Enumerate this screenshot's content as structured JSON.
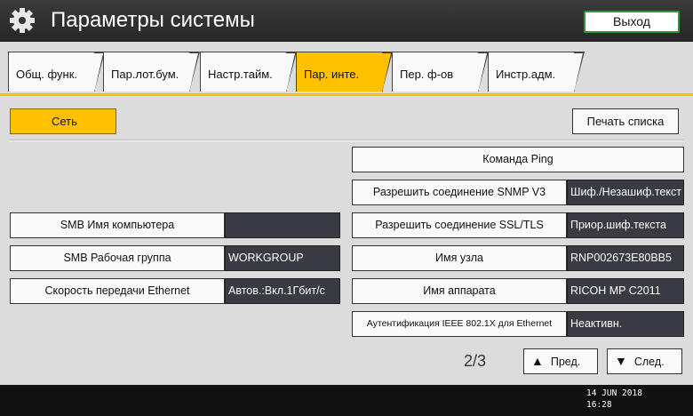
{
  "header": {
    "title": "Параметры системы",
    "exit_label": "Выход",
    "icon": "gear-icon"
  },
  "tabs": [
    {
      "label": "Общ. функ.",
      "active": false
    },
    {
      "label": "Пар.лот.бум.",
      "active": false
    },
    {
      "label": "Настр.тайм.",
      "active": false
    },
    {
      "label": "Пар. инте.",
      "active": true
    },
    {
      "label": "Пер. ф-ов",
      "active": false
    },
    {
      "label": "Инстр.адм.",
      "active": false
    }
  ],
  "toolbar": {
    "network_label": "Сеть",
    "print_list_label": "Печать списка"
  },
  "left_settings": [
    {
      "label": "SMB Имя компьютера",
      "value": ""
    },
    {
      "label": "SMB Рабочая группа",
      "value": "WORKGROUP"
    },
    {
      "label": "Скорость передачи Ethernet",
      "value": "Автов.:Вкл.1Гбит/с"
    }
  ],
  "right_settings": {
    "ping_label": "Команда Ping",
    "items": [
      {
        "label": "Разрешить соединение SNMP V3",
        "value": "Шиф./Незашиф.текст"
      },
      {
        "label": "Разрешить соединение SSL/TLS",
        "value": "Приор.шиф.текста"
      },
      {
        "label": "Имя узла",
        "value": "RNP002673E80BB5"
      },
      {
        "label": "Имя аппарата",
        "value": "RICOH MP C2011"
      },
      {
        "label": "Аутентификация IEEE 802.1X для Ethernet",
        "value": "Неактивн."
      }
    ]
  },
  "pagination": {
    "page_text": "2/3",
    "prev_label": "Пред.",
    "next_label": "След.",
    "prev_icon": "triangle-up-icon",
    "next_icon": "triangle-down-icon"
  },
  "status": {
    "date": "14 JUN  2018",
    "time": "16:28"
  },
  "colors": {
    "accent": "#ffc000",
    "title_bg": "#2f2f2f",
    "value_bg": "#3a3a42",
    "exit_border": "#2c9a3c"
  }
}
